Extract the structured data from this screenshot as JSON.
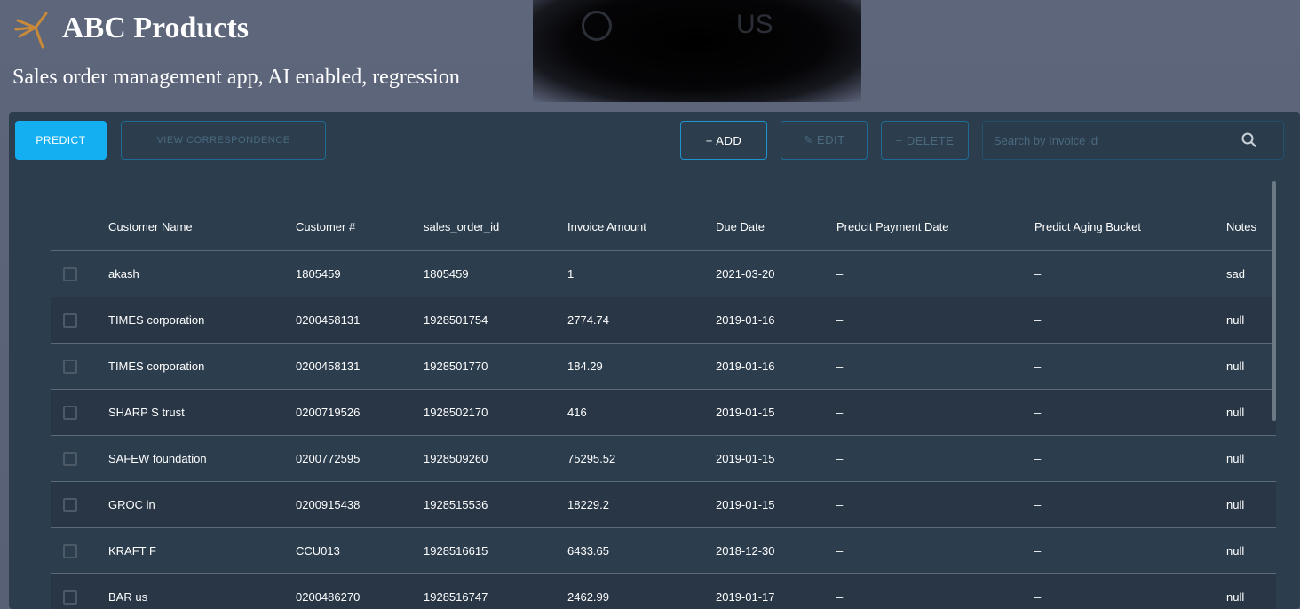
{
  "header": {
    "app_title": "ABC Products",
    "subtitle": "Sales order management app, AI enabled, regression",
    "faint_overlay_text": "US"
  },
  "toolbar": {
    "predict_label": "PREDICT",
    "view_label": "VIEW CORRESPONDENCE",
    "add_label": "+ ADD",
    "edit_label": "✎ EDIT",
    "delete_label": "− DELETE",
    "search_placeholder": "Search by Invoice id",
    "search_icon": "search-icon"
  },
  "table": {
    "columns": [
      "Customer Name",
      "Customer #",
      "sales_order_id",
      "Invoice Amount",
      "Due Date",
      "Predcit Payment Date",
      "Predict Aging Bucket",
      "Notes"
    ],
    "rows": [
      {
        "customer_name": "akash",
        "customer_no": "1805459",
        "sales_order_id": "1805459",
        "invoice_amount": "1",
        "due_date": "2021-03-20",
        "predicted_payment_date": "–",
        "aging_bucket": "–",
        "notes": "sad"
      },
      {
        "customer_name": "TIMES corporation",
        "customer_no": "0200458131",
        "sales_order_id": "1928501754",
        "invoice_amount": "2774.74",
        "due_date": "2019-01-16",
        "predicted_payment_date": "–",
        "aging_bucket": "–",
        "notes": "null"
      },
      {
        "customer_name": "TIMES corporation",
        "customer_no": "0200458131",
        "sales_order_id": "1928501770",
        "invoice_amount": "184.29",
        "due_date": "2019-01-16",
        "predicted_payment_date": "–",
        "aging_bucket": "–",
        "notes": "null"
      },
      {
        "customer_name": "SHARP S trust",
        "customer_no": "0200719526",
        "sales_order_id": "1928502170",
        "invoice_amount": "416",
        "due_date": "2019-01-15",
        "predicted_payment_date": "–",
        "aging_bucket": "–",
        "notes": "null"
      },
      {
        "customer_name": "SAFEW foundation",
        "customer_no": "0200772595",
        "sales_order_id": "1928509260",
        "invoice_amount": "75295.52",
        "due_date": "2019-01-15",
        "predicted_payment_date": "–",
        "aging_bucket": "–",
        "notes": "null"
      },
      {
        "customer_name": "GROC in",
        "customer_no": "0200915438",
        "sales_order_id": "1928515536",
        "invoice_amount": "18229.2",
        "due_date": "2019-01-15",
        "predicted_payment_date": "–",
        "aging_bucket": "–",
        "notes": "null"
      },
      {
        "customer_name": "KRAFT F",
        "customer_no": "CCU013",
        "sales_order_id": "1928516615",
        "invoice_amount": "6433.65",
        "due_date": "2018-12-30",
        "predicted_payment_date": "–",
        "aging_bucket": "–",
        "notes": "null"
      },
      {
        "customer_name": "BAR us",
        "customer_no": "0200486270",
        "sales_order_id": "1928516747",
        "invoice_amount": "2462.99",
        "due_date": "2019-01-17",
        "predicted_payment_date": "–",
        "aging_bucket": "–",
        "notes": "null"
      }
    ]
  },
  "colors": {
    "accent": "#14aff1",
    "panel": "#2c3d4d",
    "background": "#5b6479"
  }
}
